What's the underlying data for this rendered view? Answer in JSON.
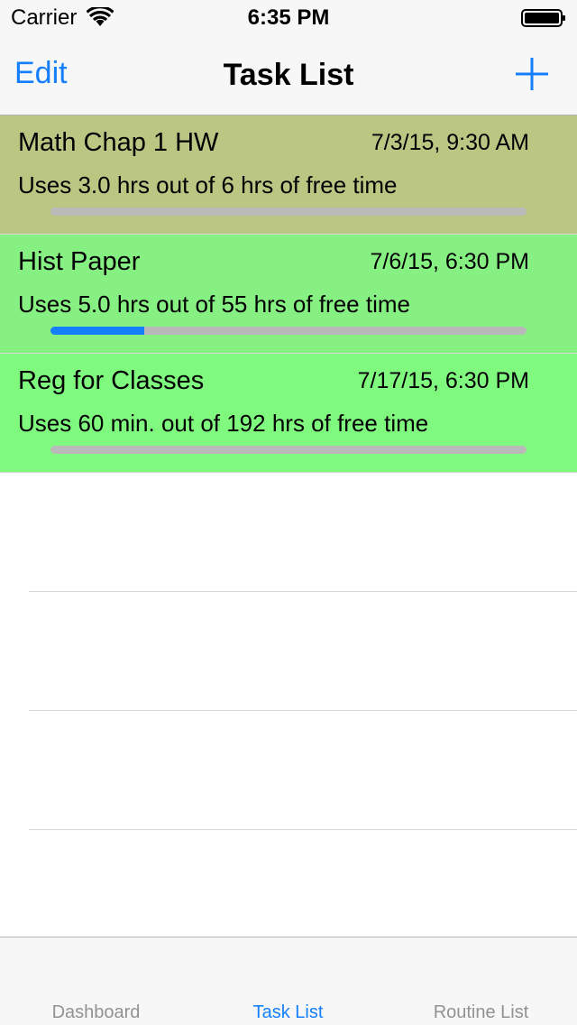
{
  "status_bar": {
    "carrier": "Carrier",
    "time": "6:35 PM",
    "wifi_icon": "wifi-icon",
    "battery_icon": "battery-icon"
  },
  "nav_bar": {
    "edit_label": "Edit",
    "title": "Task List",
    "add_icon": "plus-icon"
  },
  "tasks": [
    {
      "name": "Math Chap 1 HW",
      "date": "7/3/15, 9:30 AM",
      "usage": "Uses 3.0 hrs out of 6 hrs of free time",
      "progress": 0,
      "row_color": "#bcc683"
    },
    {
      "name": "Hist Paper",
      "date": "7/6/15, 6:30 PM",
      "usage": "Uses 5.0 hrs out of 55 hrs of free time",
      "progress": 0.197,
      "row_color": "#86f182"
    },
    {
      "name": "Reg for Classes",
      "date": "7/17/15, 6:30 PM",
      "usage": "Uses 60 min. out of 192 hrs of free time",
      "progress": 0,
      "row_color": "#80f97f"
    }
  ],
  "tab_bar": {
    "tabs": [
      {
        "label": "Dashboard",
        "active": false
      },
      {
        "label": "Task List",
        "active": true
      },
      {
        "label": "Routine List",
        "active": false
      }
    ]
  },
  "colors": {
    "accent": "#157efb",
    "track": "#b9b9b9"
  }
}
